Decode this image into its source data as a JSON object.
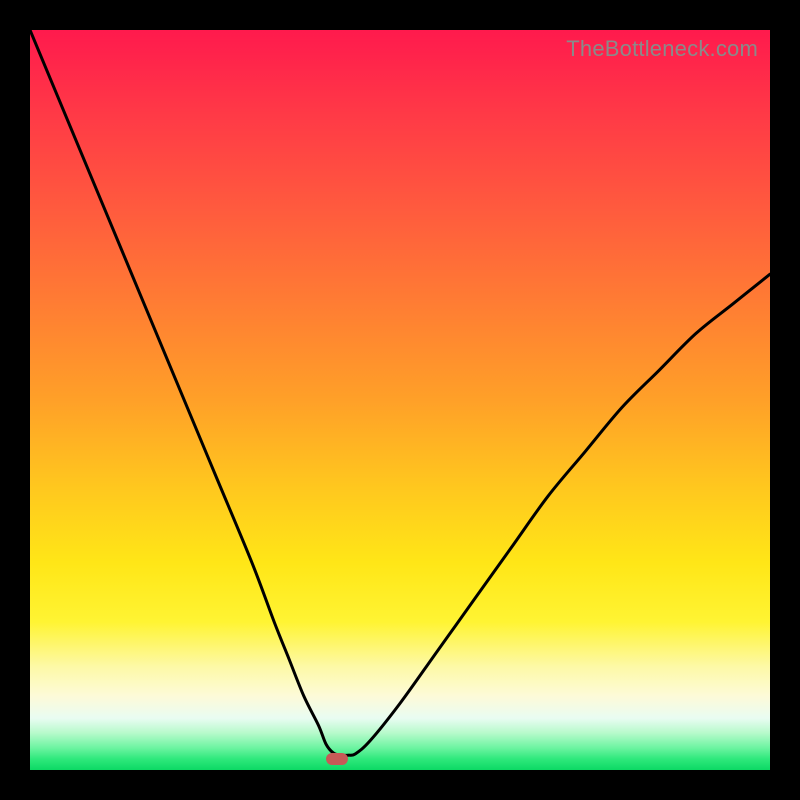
{
  "watermark": "TheBottleneck.com",
  "colors": {
    "curve": "#000000",
    "marker": "#c65a57"
  },
  "chart_data": {
    "type": "line",
    "title": "",
    "xlabel": "",
    "ylabel": "",
    "xlim": [
      0,
      100
    ],
    "ylim": [
      0,
      100
    ],
    "grid": false,
    "legend": false,
    "annotations": [
      {
        "type": "marker",
        "x": 41.5,
        "y": 1.5
      }
    ],
    "series": [
      {
        "name": "bottleneck-curve",
        "x": [
          0,
          5,
          10,
          15,
          20,
          25,
          30,
          33,
          35,
          37,
          39,
          40,
          41,
          42,
          43,
          44,
          46,
          50,
          55,
          60,
          65,
          70,
          75,
          80,
          85,
          90,
          95,
          100
        ],
        "y": [
          100,
          88,
          76,
          64,
          52,
          40,
          28,
          20,
          15,
          10,
          6,
          3.5,
          2.3,
          2.0,
          2.0,
          2.2,
          4,
          9,
          16,
          23,
          30,
          37,
          43,
          49,
          54,
          59,
          63,
          67
        ]
      }
    ]
  }
}
